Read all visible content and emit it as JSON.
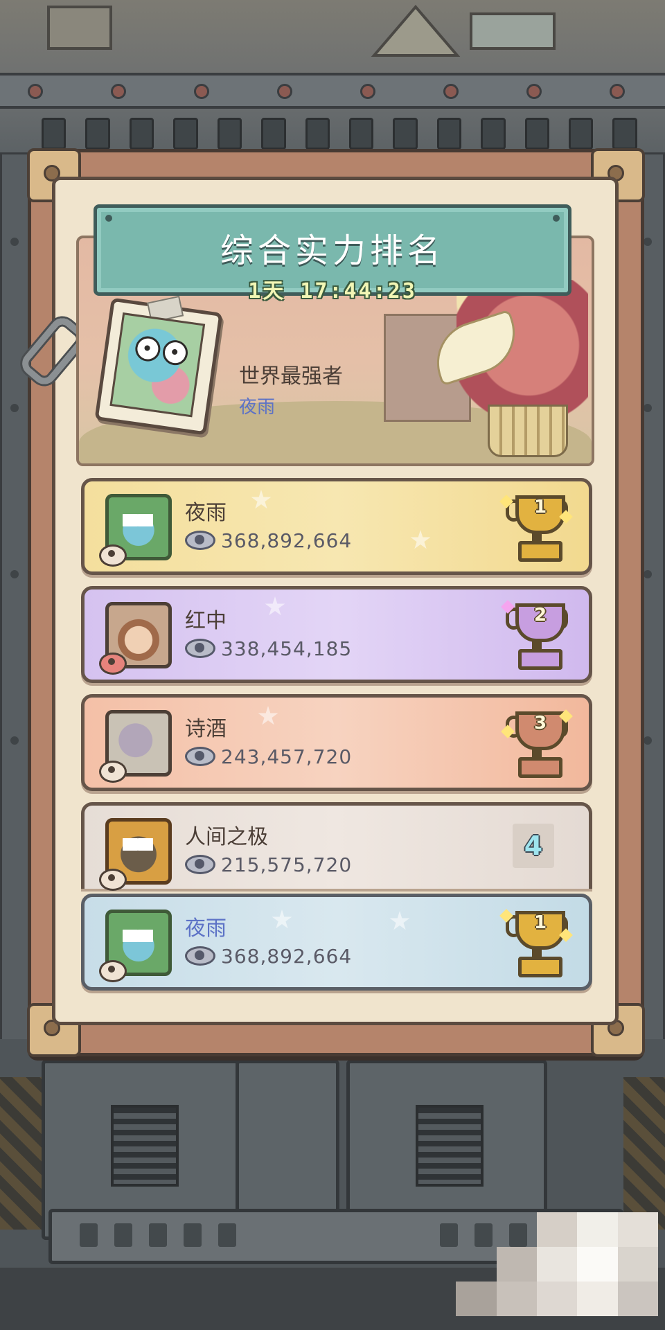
{
  "ranking": {
    "title": "综合实力排名",
    "countdown": "1天 17:44:23",
    "champion": {
      "label": "世界最强者",
      "name": "夜雨"
    },
    "rows": [
      {
        "rank": "1",
        "name": "夜雨",
        "power": "368,892,664",
        "style": "gold",
        "trophy": "gold-trophy-icon"
      },
      {
        "rank": "2",
        "name": "红中",
        "power": "338,454,185",
        "style": "purple",
        "trophy": "silver-trophy-icon"
      },
      {
        "rank": "3",
        "name": "诗酒",
        "power": "243,457,720",
        "style": "orange",
        "trophy": "bronze-trophy-icon"
      },
      {
        "rank": "4",
        "name": "人间之极",
        "power": "215,575,720",
        "style": "grey",
        "trophy": ""
      }
    ],
    "my_rank": {
      "rank": "1",
      "name": "夜雨",
      "power": "368,892,664",
      "trophy": "gold-trophy-icon"
    }
  },
  "colors": {
    "title_banner": "#7ab8ad",
    "row_gold": "#f4df9d",
    "row_silver": "#d5c2f0",
    "row_bronze": "#f4c0a7",
    "row_other": "#e6ddd6",
    "row_mine": "#c7dde8",
    "player_name_highlight": "#5c72c6"
  }
}
